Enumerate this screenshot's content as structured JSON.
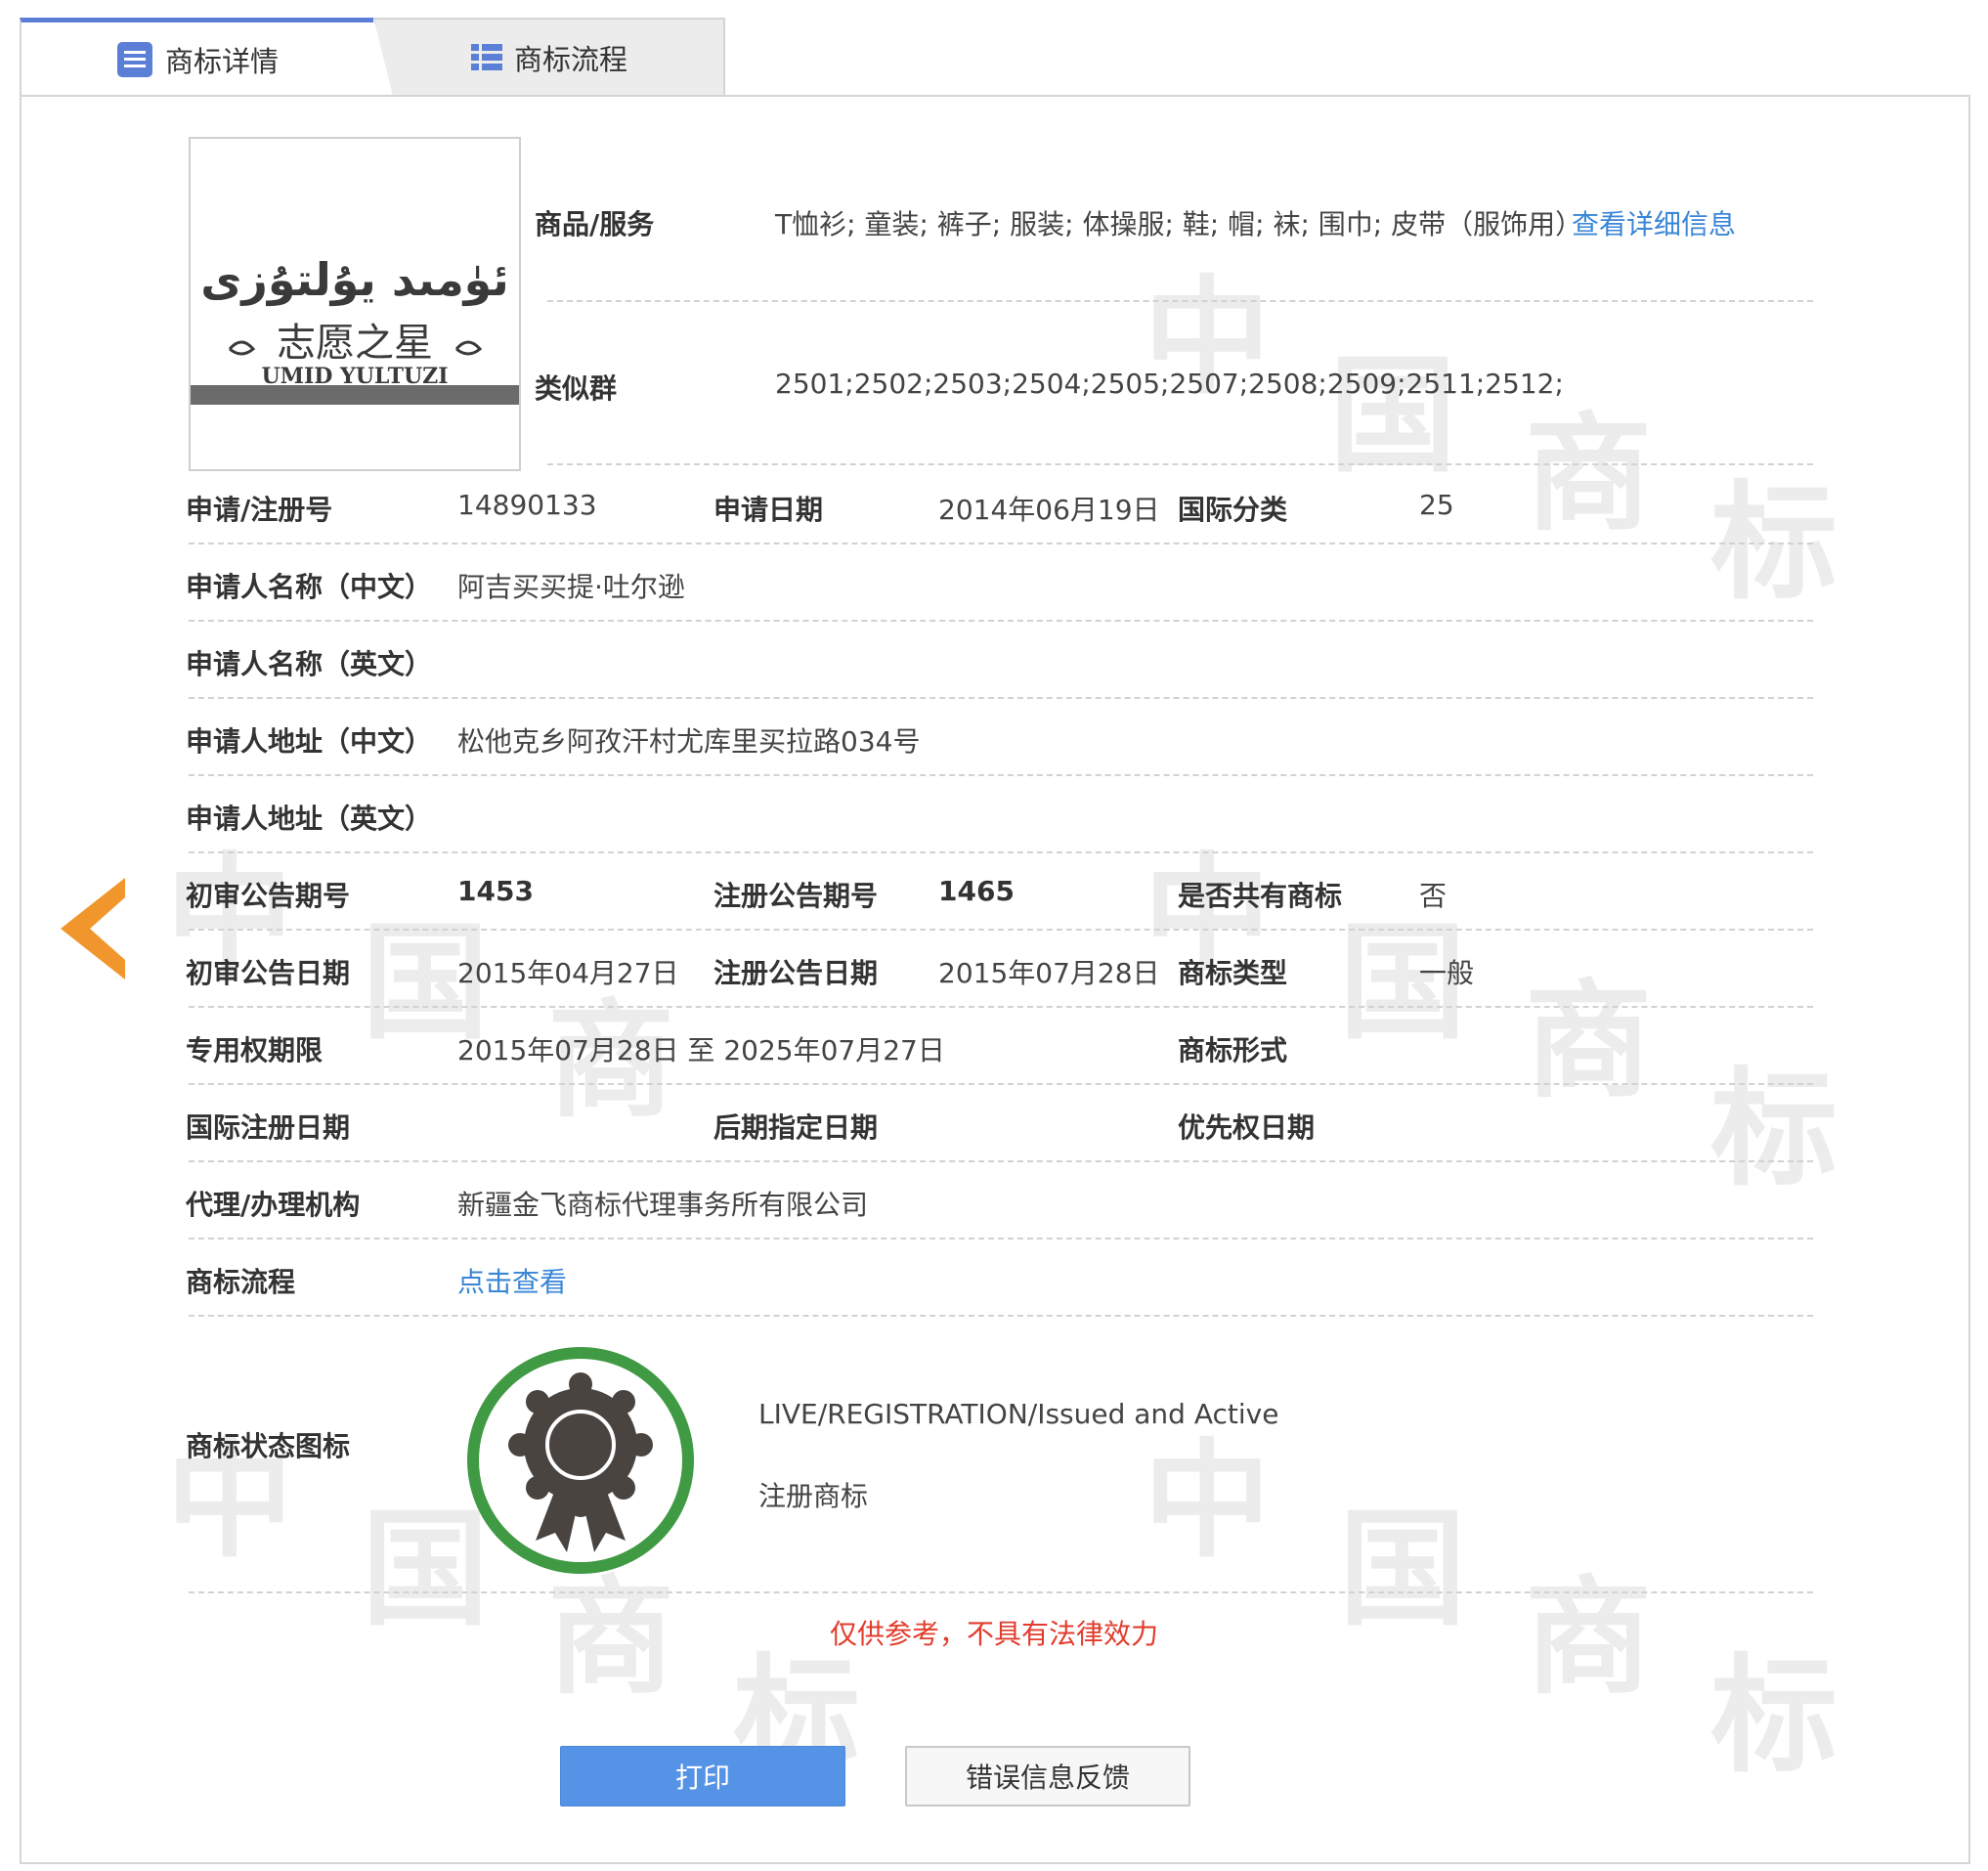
{
  "tabs": [
    {
      "label": "商标详情",
      "icon": "list-icon",
      "active": true
    },
    {
      "label": "商标流程",
      "icon": "flow-list-icon",
      "active": false
    }
  ],
  "logo": {
    "text_lines": [
      "ئۈمىد يۇلتۇزى",
      "志愿之星",
      "UMID YULTUZI"
    ]
  },
  "goods": {
    "label": "商品/服务",
    "value": "T恤衫; 童装; 裤子; 服装; 体操服; 鞋; 帽; 袜; 围巾; 皮带（服饰用）",
    "link": "查看详细信息"
  },
  "similar_group": {
    "label": "类似群",
    "value": "2501;2502;2503;2504;2505;2507;2508;2509;2511;2512;"
  },
  "rows": {
    "reg_no": {
      "label": "申请/注册号",
      "value": "14890133"
    },
    "app_date": {
      "label": "申请日期",
      "value": "2014年06月19日"
    },
    "intl_class": {
      "label": "国际分类",
      "value": "25"
    },
    "applicant_cn": {
      "label": "申请人名称（中文）",
      "value": "阿吉买买提·吐尔逊"
    },
    "applicant_en": {
      "label": "申请人名称（英文）",
      "value": ""
    },
    "address_cn": {
      "label": "申请人地址（中文）",
      "value": "松他克乡阿孜汗村尤库里买拉路034号"
    },
    "address_en": {
      "label": "申请人地址（英文）",
      "value": ""
    },
    "prelim_issue": {
      "label": "初审公告期号",
      "value": "1453"
    },
    "reg_issue": {
      "label": "注册公告期号",
      "value": "1465"
    },
    "shared": {
      "label": "是否共有商标",
      "value": "否"
    },
    "prelim_date": {
      "label": "初审公告日期",
      "value": "2015年04月27日"
    },
    "reg_date": {
      "label": "注册公告日期",
      "value": "2015年07月28日"
    },
    "tm_type": {
      "label": "商标类型",
      "value": "一般"
    },
    "exclusive_period": {
      "label": "专用权期限",
      "value": "2015年07月28日 至 2025年07月27日"
    },
    "tm_form": {
      "label": "商标形式",
      "value": ""
    },
    "intl_reg_date": {
      "label": "国际注册日期",
      "value": ""
    },
    "later_designation": {
      "label": "后期指定日期",
      "value": ""
    },
    "priority_date": {
      "label": "优先权日期",
      "value": ""
    },
    "agency": {
      "label": "代理/办理机构",
      "value": "新疆金飞商标代理事务所有限公司"
    },
    "process": {
      "label": "商标流程",
      "link": "点击查看"
    },
    "status_icon": {
      "label": "商标状态图标",
      "status_en": "LIVE/REGISTRATION/Issued and Active",
      "status_cn": "注册商标"
    }
  },
  "notice": "仅供参考，不具有法律效力",
  "buttons": {
    "print": "打印",
    "feedback": "错误信息反馈"
  },
  "watermark": [
    "中",
    "国",
    "商",
    "标"
  ],
  "colors": {
    "accent": "#5593e6",
    "link": "#3a86d6",
    "notice": "#e23c2c",
    "arrow": "#f0962c",
    "badge_ring": "#3f9a43"
  }
}
